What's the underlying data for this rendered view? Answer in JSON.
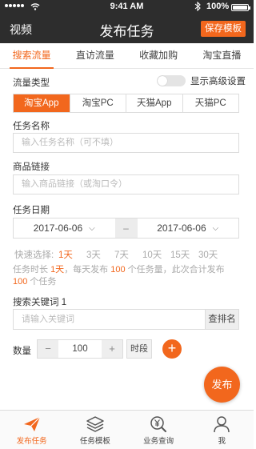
{
  "status_bar": {
    "time": "9:41 AM",
    "battery": "100%"
  },
  "navbar": {
    "left_label": "视频",
    "title": "发布任务",
    "save_button": "保存模板"
  },
  "tabs": [
    {
      "label": "搜索流量",
      "active": true
    },
    {
      "label": "直访流量",
      "active": false
    },
    {
      "label": "收藏加购",
      "active": false
    },
    {
      "label": "淘宝直播",
      "active": false
    }
  ],
  "form": {
    "flow_type_label": "流量类型",
    "advanced_label": "显示高级设置",
    "platforms": [
      {
        "label": "淘宝App",
        "active": true
      },
      {
        "label": "淘宝PC",
        "active": false
      },
      {
        "label": "天猫App",
        "active": false
      },
      {
        "label": "天猫PC",
        "active": false
      }
    ],
    "task_name": {
      "label": "任务名称",
      "placeholder": "输入任务名称（可不填）"
    },
    "product_link": {
      "label": "商品链接",
      "placeholder": "输入商品链接（或淘口令）"
    },
    "task_date": {
      "label": "任务日期",
      "start": "2017-06-06",
      "separator": "–",
      "end": "2017-06-06"
    },
    "quick_select": {
      "label": "快速选择:",
      "options": [
        {
          "label": "1天",
          "active": true
        },
        {
          "label": "3天",
          "active": false
        },
        {
          "label": "7天",
          "active": false
        },
        {
          "label": "10天",
          "active": false
        },
        {
          "label": "15天",
          "active": false
        },
        {
          "label": "30天",
          "active": false
        }
      ]
    },
    "summary": {
      "t1": "任务时长",
      "days": "1天",
      "t2": "，每天发布",
      "per_day": "100",
      "t3": "个任务量，此次合计发布",
      "total": "100",
      "t4": "个任务"
    },
    "keyword": {
      "label": "搜索关键词 1",
      "placeholder": "请输入关键词",
      "button": "查排名"
    },
    "quantity": {
      "label": "数量",
      "minus": "−",
      "value": "100",
      "plus": "+",
      "time_button": "时段",
      "add": "+"
    }
  },
  "fab_label": "发布",
  "bottom_nav": [
    {
      "label": "发布任务",
      "icon": "send-icon",
      "active": true
    },
    {
      "label": "任务模板",
      "icon": "layers-icon",
      "active": false
    },
    {
      "label": "业务查询",
      "icon": "search-yen-icon",
      "active": false
    },
    {
      "label": "我",
      "icon": "user-icon",
      "active": false
    }
  ],
  "colors": {
    "accent": "#f2671d",
    "header": "#2d2d2d"
  }
}
